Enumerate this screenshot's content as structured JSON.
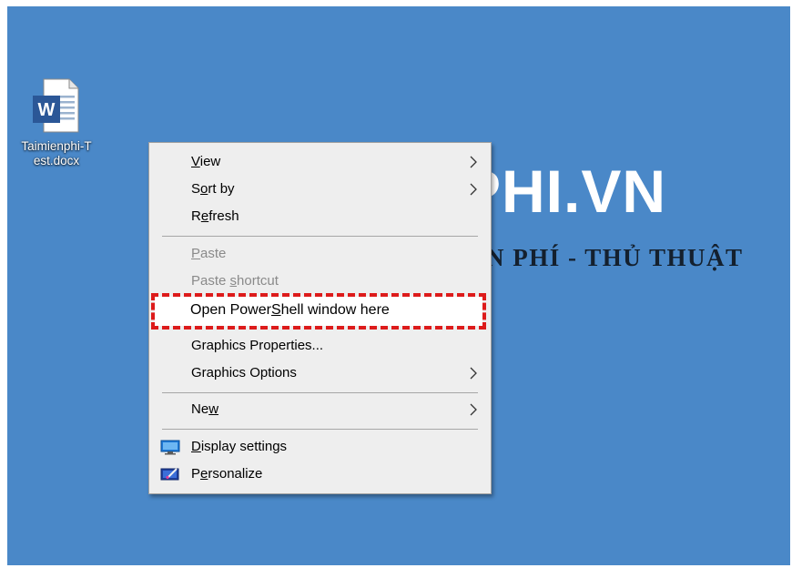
{
  "desktop": {
    "background_color": "#4a88c8",
    "icon": {
      "label_line1": "Taimienphi-T",
      "label_line2": "est.docx",
      "icon_name": "word-document-icon"
    },
    "watermark": {
      "brand": "PHI.VN",
      "tagline": "N PHÍ - THỦ THUẬT"
    }
  },
  "context_menu": {
    "items": [
      {
        "pre": "",
        "u": "V",
        "post": "iew",
        "submenu": true,
        "disabled": false
      },
      {
        "pre": "S",
        "u": "o",
        "post": "rt by",
        "submenu": true,
        "disabled": false
      },
      {
        "pre": "R",
        "u": "e",
        "post": "fresh",
        "submenu": false,
        "disabled": false
      },
      {
        "pre": "",
        "u": "P",
        "post": "aste",
        "submenu": false,
        "disabled": true
      },
      {
        "pre": "Paste ",
        "u": "s",
        "post": "hortcut",
        "submenu": false,
        "disabled": true
      },
      {
        "pre": "Open Power",
        "u": "S",
        "post": "hell window here",
        "submenu": false,
        "disabled": false
      },
      {
        "pre": "Graphics Properties...",
        "u": "",
        "post": "",
        "submenu": false,
        "disabled": false
      },
      {
        "pre": "Graphics Options",
        "u": "",
        "post": "",
        "submenu": true,
        "disabled": false
      },
      {
        "pre": "Ne",
        "u": "w",
        "post": "",
        "submenu": true,
        "disabled": false
      },
      {
        "pre": "",
        "u": "D",
        "post": "isplay settings",
        "submenu": false,
        "disabled": false,
        "icon": "display-settings-icon"
      },
      {
        "pre": "P",
        "u": "e",
        "post": "rsonalize",
        "submenu": false,
        "disabled": false,
        "icon": "personalize-icon"
      }
    ],
    "highlight_color": "#dd1b1b"
  }
}
